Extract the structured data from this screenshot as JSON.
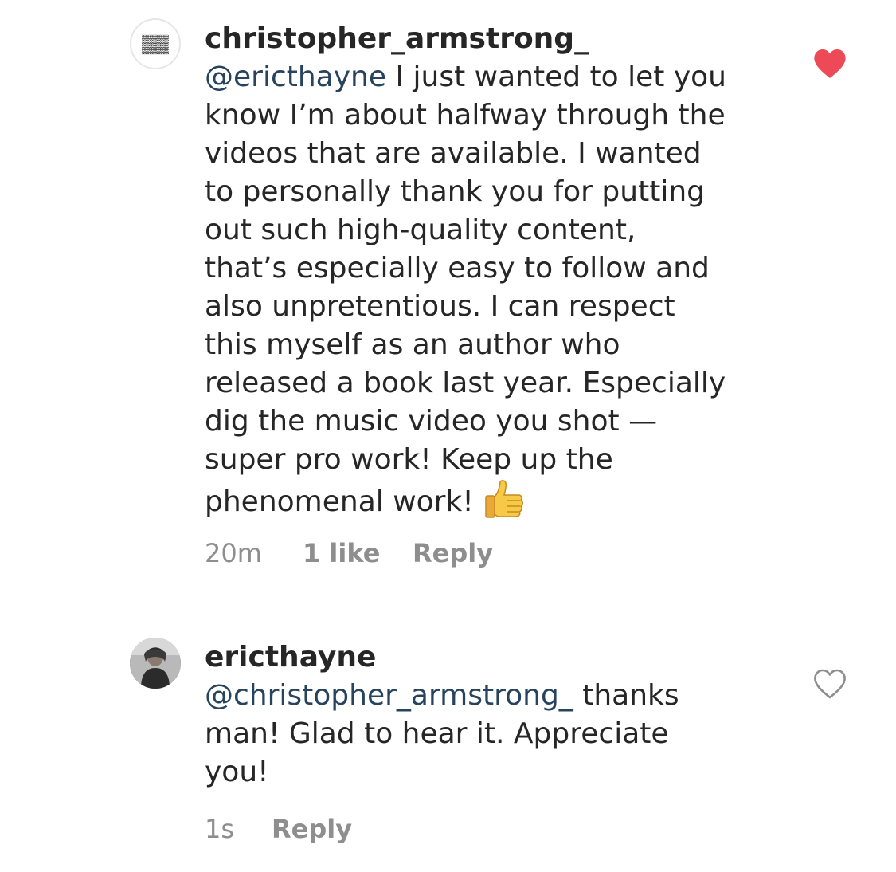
{
  "comments": [
    {
      "username": "christopher_armstrong_",
      "avatar_icon": "patterned-avatar-icon",
      "text_lines": [
        {
          "mention": "@ericthayne",
          "text": " I just wanted to let you"
        },
        {
          "mention": "",
          "text": "know I’m about halfway through the"
        },
        {
          "mention": "",
          "text": "videos that are available. I wanted"
        },
        {
          "mention": "",
          "text": "to personally thank you for putting"
        },
        {
          "mention": "",
          "text": "out such high-quality content,"
        },
        {
          "mention": "",
          "text": "that’s especially easy to follow and"
        },
        {
          "mention": "",
          "text": "also unpretentious. I can respect"
        },
        {
          "mention": "",
          "text": "this myself as an author who"
        },
        {
          "mention": "",
          "text": "released a book last year. Especially"
        },
        {
          "mention": "",
          "text": "dig the music video you shot —"
        },
        {
          "mention": "",
          "text": "super pro work! Keep up the"
        },
        {
          "mention": "",
          "text": "phenomenal work!"
        }
      ],
      "emoji": "thumbs-up-emoji",
      "time": "20m",
      "likes": "1 like",
      "reply_label": "Reply",
      "liked": true,
      "heart_color": "#ed4956"
    },
    {
      "username": "ericthayne",
      "avatar_icon": "profile-photo-avatar",
      "text_lines": [
        {
          "mention": "@christopher_armstrong_",
          "text": " thanks"
        },
        {
          "mention": "",
          "text": "man! Glad to hear it. Appreciate"
        },
        {
          "mention": "",
          "text": "you!"
        }
      ],
      "time": "1s",
      "reply_label": "Reply",
      "liked": false,
      "heart_color": "#8e8e8e"
    }
  ],
  "colors": {
    "mention": "#27435d",
    "text": "#262626",
    "meta": "#8e8e8e"
  }
}
